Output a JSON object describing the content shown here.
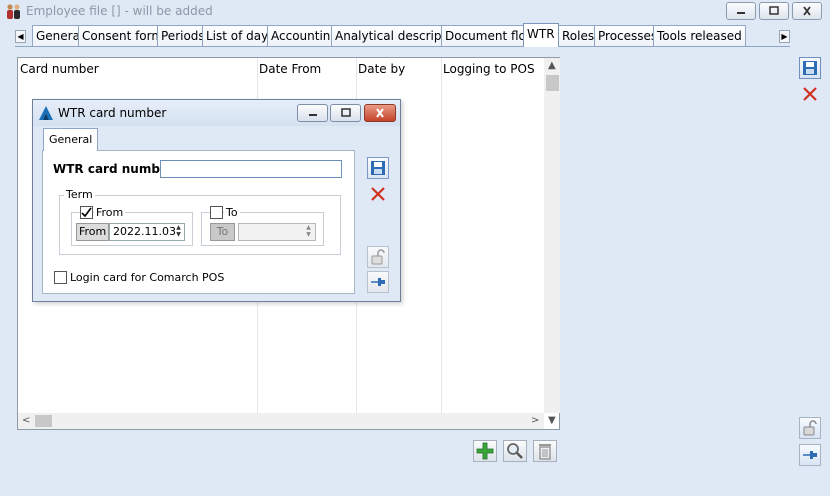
{
  "window": {
    "title": "Employee file [] - will be added",
    "controls": [
      "minimize-icon",
      "maximize-icon",
      "close-icon"
    ]
  },
  "tabs": [
    {
      "label": "General"
    },
    {
      "label": "Consent forms"
    },
    {
      "label": "Periods"
    },
    {
      "label": "List of days"
    },
    {
      "label": "Accounting"
    },
    {
      "label": "Analytical description"
    },
    {
      "label": "Document flow"
    },
    {
      "label": "WTR",
      "active": true
    },
    {
      "label": "Roles"
    },
    {
      "label": "Processes"
    },
    {
      "label": "Tools released"
    }
  ],
  "list": {
    "columns": [
      "Card number",
      "Date From",
      "Date by",
      "Logging to POS"
    ],
    "rows": []
  },
  "side_toolbar": [
    "save-icon",
    "cancel-icon",
    "lock-icon",
    "pin-icon"
  ],
  "bottom_toolbar": [
    "add-icon",
    "search-icon",
    "delete-icon"
  ],
  "dialog": {
    "title": "WTR card number",
    "tab": "General",
    "card_number_label": "WTR card number:",
    "card_number_value": "",
    "term_label": "Term",
    "from": {
      "checked": true,
      "label": "From",
      "button": "From",
      "date": "2022.11.03"
    },
    "to": {
      "checked": false,
      "label": "To",
      "button": "To",
      "date": ""
    },
    "login_card_label": "Login card for Comarch POS",
    "login_card_checked": false,
    "colors": {
      "accent": "#1b6fb8",
      "cancel": "#d03020",
      "add": "#3aa63a"
    }
  }
}
